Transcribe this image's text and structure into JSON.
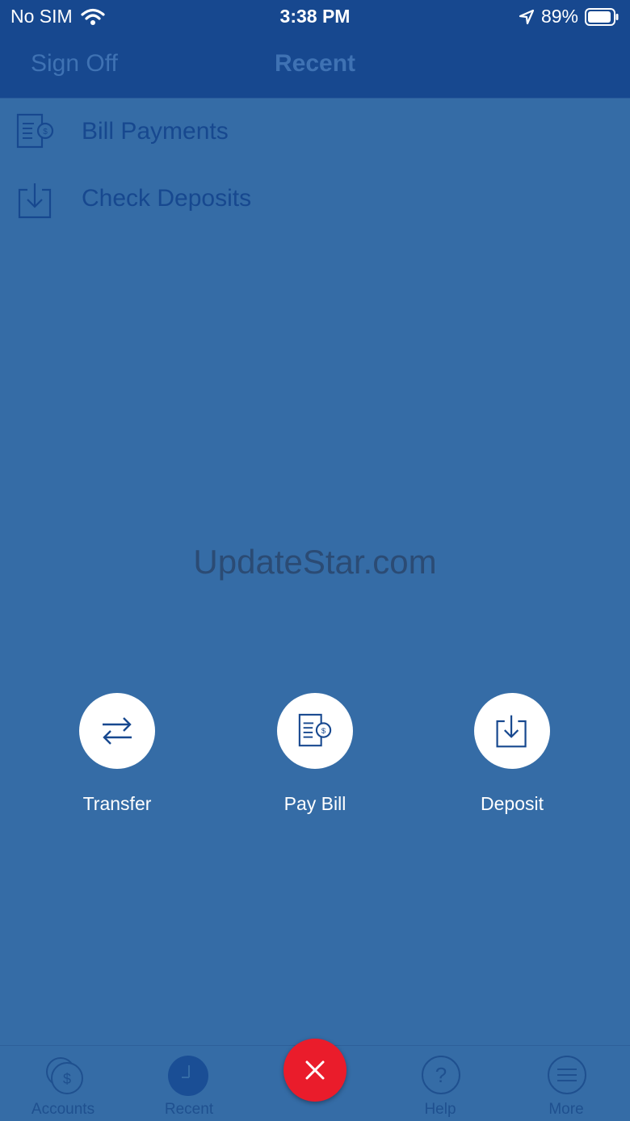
{
  "status_bar": {
    "carrier": "No SIM",
    "time": "3:38 PM",
    "battery": "89%"
  },
  "nav": {
    "left_button": "Sign Off",
    "title": "Recent"
  },
  "recent_items": [
    {
      "label": "Bill Payments",
      "icon": "bill-icon"
    },
    {
      "label": "Check Deposits",
      "icon": "deposit-icon"
    }
  ],
  "watermark": "UpdateStar.com",
  "actions": [
    {
      "label": "Transfer",
      "icon": "transfer-icon"
    },
    {
      "label": "Pay Bill",
      "icon": "bill-icon"
    },
    {
      "label": "Deposit",
      "icon": "deposit-icon"
    }
  ],
  "tabs": [
    {
      "label": "Accounts",
      "icon": "dollar-coins-icon"
    },
    {
      "label": "Recent",
      "icon": "clock-icon"
    },
    {
      "label": "Help",
      "icon": "question-icon"
    },
    {
      "label": "More",
      "icon": "menu-icon"
    }
  ],
  "colors": {
    "nav_background": "#17488f",
    "page_background": "#356ca6",
    "close_button": "#ea1c2b"
  }
}
